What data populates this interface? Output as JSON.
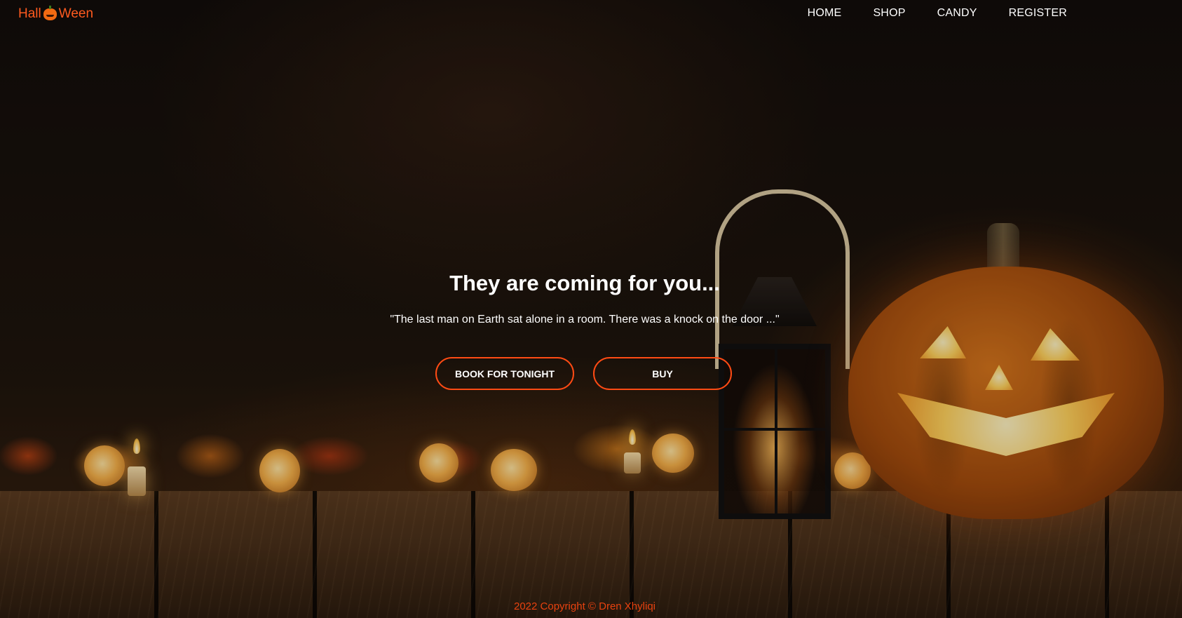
{
  "navbar": {
    "logo_left": "Hall",
    "logo_icon": "pumpkin-icon",
    "logo_right": "Ween",
    "links": [
      "HOME",
      "SHOP",
      "CANDY",
      "REGISTER"
    ]
  },
  "hero": {
    "title": "They are coming for you...",
    "quote": "\"The last man on Earth sat alone in a room. There was a knock on the door ...\"",
    "buttons": {
      "book": "BOOK FOR TONIGHT",
      "buy": "BUY"
    }
  },
  "footer": {
    "text": "2022 Copyright © Dren Xhyliqi"
  },
  "colors": {
    "accent": "#ff4b14",
    "logo": "#ff5a1f",
    "text": "#ffffff",
    "footer": "#e8420f"
  }
}
